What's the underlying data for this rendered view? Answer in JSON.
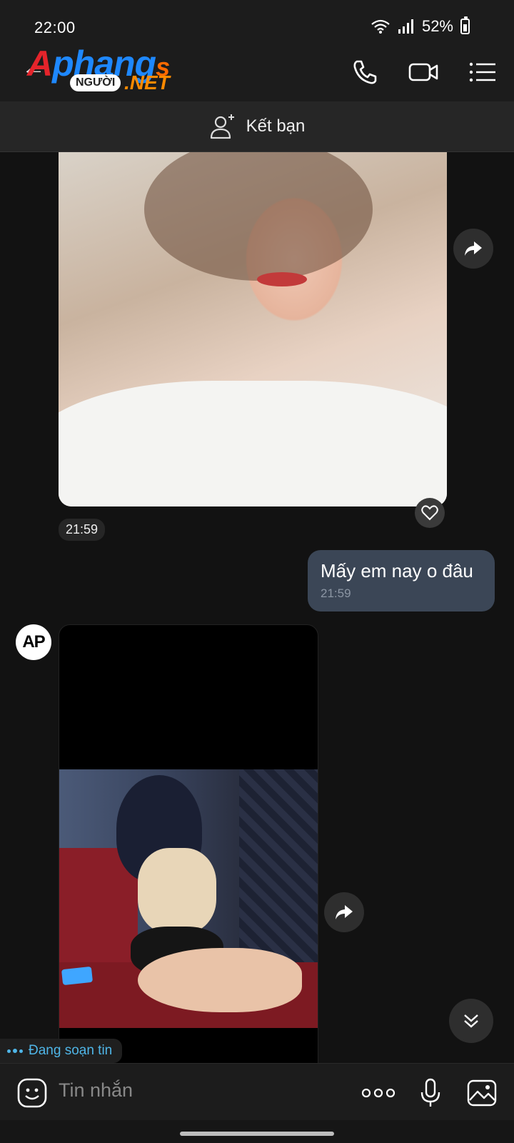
{
  "status_bar": {
    "time": "22:00",
    "battery": "52%"
  },
  "header": {
    "logo_main": "Aphang",
    "logo_main_first": "A",
    "logo_main_rest": "phang",
    "logo_suffix": "s",
    "logo_sub": "NGƯỜI",
    "logo_net": ".NET",
    "icons": [
      "back-arrow-icon",
      "phone-icon",
      "video-call-icon",
      "menu-icon"
    ]
  },
  "friend_bar": {
    "label": "Kết bạn",
    "icon": "add-user-icon"
  },
  "messages": [
    {
      "type": "image",
      "time": "21:59",
      "sender": "contact"
    },
    {
      "type": "text",
      "text": "Mấy em nay o đâu",
      "time": "21:59",
      "sender": "me"
    },
    {
      "type": "image",
      "sender": "contact",
      "avatar_text": "AP"
    }
  ],
  "typing_indicator": "Đang soạn tin",
  "input": {
    "placeholder": "Tin nhắn"
  },
  "colors": {
    "background": "#121212",
    "header": "#1c1c1c",
    "my_bubble": "#3b4656",
    "typing": "#4fb6e8"
  }
}
